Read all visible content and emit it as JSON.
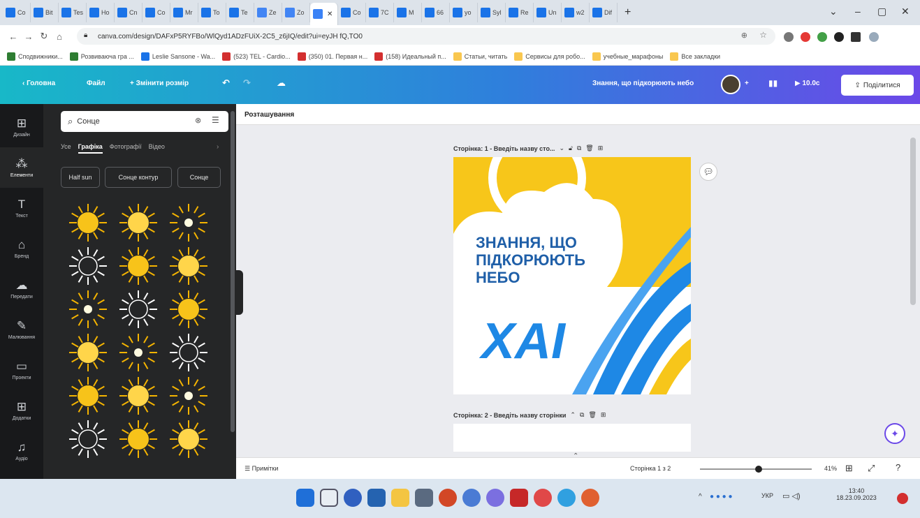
{
  "browser": {
    "tabs": [
      {
        "label": "Co",
        "color": "#1a73e8"
      },
      {
        "label": "Bit",
        "color": "#1a73e8"
      },
      {
        "label": "Tes",
        "color": "#1a73e8"
      },
      {
        "label": "Ho",
        "color": "#1a73e8"
      },
      {
        "label": "Cn",
        "color": "#1a73e8"
      },
      {
        "label": "Co",
        "color": "#1a73e8"
      },
      {
        "label": "Mr",
        "color": "#1a73e8"
      },
      {
        "label": "To",
        "color": "#1a73e8"
      },
      {
        "label": "Te",
        "color": "#1a73e8"
      },
      {
        "label": "Ze",
        "color": "#4285f4"
      },
      {
        "label": "Zo",
        "color": "#4285f4"
      },
      {
        "label": "",
        "color": "#3b82f6",
        "active": true
      },
      {
        "label": "Co",
        "color": "#1a73e8"
      },
      {
        "label": "7C",
        "color": "#1a73e8"
      },
      {
        "label": "M",
        "color": "#1a73e8"
      },
      {
        "label": "66",
        "color": "#1a73e8"
      },
      {
        "label": "yo",
        "color": "#1a73e8"
      },
      {
        "label": "Syl",
        "color": "#1a73e8"
      },
      {
        "label": "Re",
        "color": "#1a73e8"
      },
      {
        "label": "Un",
        "color": "#1a73e8"
      },
      {
        "label": "w2",
        "color": "#1a73e8"
      },
      {
        "label": "Dif",
        "color": "#1a73e8"
      }
    ],
    "new_tab": "+",
    "url": "canva.com/design/DAFxP5RYFBo/WlQyd1ADzFUiX-2C5_z6jIQ/edit?ui=eyJH fQ,TO0",
    "bookmarks": [
      {
        "label": "Сподвижники...",
        "color": "#2e7d32"
      },
      {
        "label": "Розвиваюча гра ...",
        "color": "#2e7d32"
      },
      {
        "label": "Leslie Sansone - Wa...",
        "color": "#1a73e8"
      },
      {
        "label": "(523) TEL - Cardio...",
        "color": "#d32f2f"
      },
      {
        "label": "(350) 01. Первая н...",
        "color": "#d32f2f"
      },
      {
        "label": "(158) Идеальный п...",
        "color": "#d32f2f"
      },
      {
        "label": "Статьи, читать",
        "color": "#f9c74f"
      },
      {
        "label": "Сервисы для робо...",
        "color": "#f9c74f"
      },
      {
        "label": "учебные_марафоны",
        "color": "#f9c74f"
      },
      {
        "label": "Все закладки",
        "color": "#f9c74f"
      }
    ]
  },
  "canva": {
    "topbar": {
      "home": "Головна",
      "file": "Файл",
      "resize": "Змінити розмір",
      "doc_title": "Знання, що підкорюють небо",
      "timer": "10.0с",
      "share": "Поділитися"
    },
    "rail": [
      {
        "label": "Дизайн",
        "icon": "template-icon"
      },
      {
        "label": "Елементи",
        "icon": "elements-icon",
        "active": true
      },
      {
        "label": "Текст",
        "icon": "text-icon"
      },
      {
        "label": "Бренд",
        "icon": "brand-icon"
      },
      {
        "label": "Передати",
        "icon": "uploads-icon"
      },
      {
        "label": "Малювання",
        "icon": "draw-icon"
      },
      {
        "label": "Проекти",
        "icon": "projects-icon"
      },
      {
        "label": "Додатки",
        "icon": "apps-icon"
      },
      {
        "label": "Аудіо",
        "icon": "audio-icon"
      }
    ],
    "panel": {
      "search_value": "Сонце",
      "tabs": [
        "Усе",
        "Графіка",
        "Фотографії",
        "Відео"
      ],
      "active_tab": "Графіка",
      "chips": [
        "Half sun",
        "Сонце контур",
        "Сонце"
      ]
    },
    "workspace": {
      "header": "Розташування",
      "page1_label": "Сторінка: 1 - Введіть назву сто...",
      "page2_label": "Сторінка: 2 - Введіть назву сторінки",
      "design_text": [
        "ЗНАННЯ, ЩО",
        "ПІДКОРЮЮТЬ",
        "НЕБО"
      ],
      "logo_text": "ХАІ"
    },
    "footer": {
      "notes": "Примітки",
      "page_count": "Сторінка 1 з 2",
      "zoom": "41%",
      "zoom_fraction": 0.41
    }
  },
  "taskbar": {
    "lang": "УКР",
    "time": "13:40",
    "date": "18.23.09.2023"
  },
  "colors": {
    "canva_gradient_start": "#18b8c8",
    "canva_gradient_end": "#6b48e8",
    "sun_yellow": "#f7c61a",
    "blue": "#1e88e5"
  }
}
